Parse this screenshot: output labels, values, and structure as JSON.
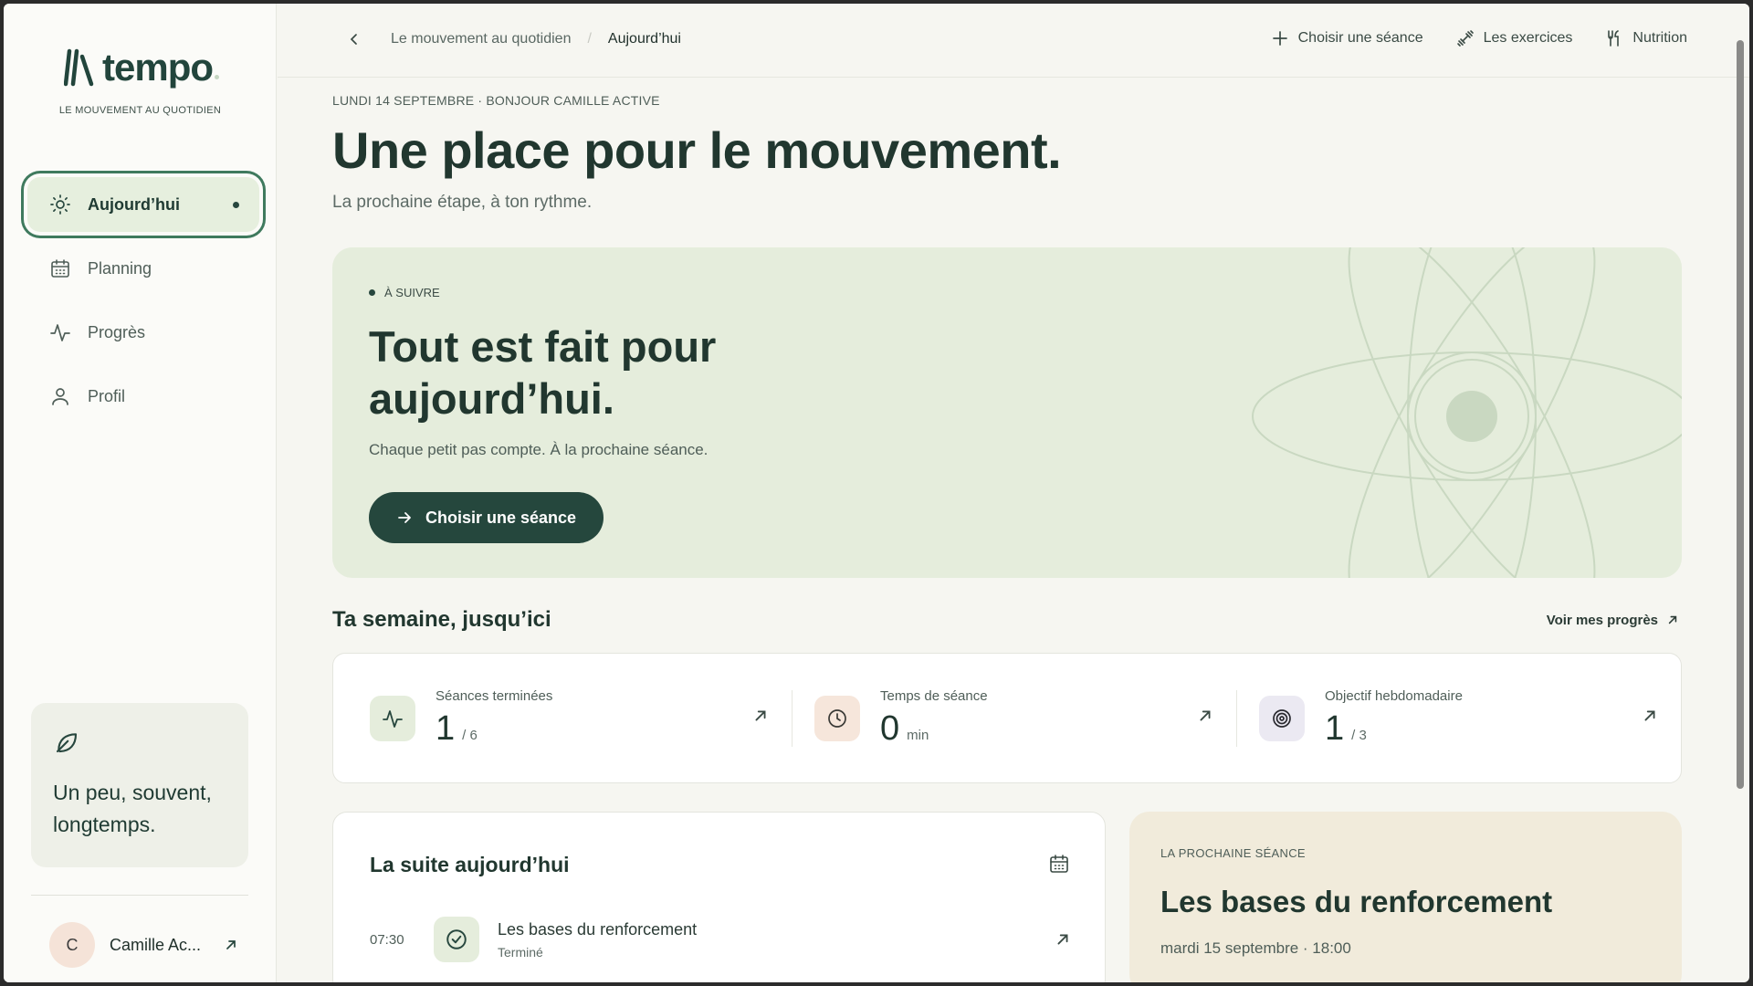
{
  "app": {
    "name": "tempo",
    "tagline": "LE MOUVEMENT AU QUOTIDIEN"
  },
  "sidebar": {
    "items": [
      {
        "label": "Aujourd’hui",
        "icon": "sun-icon",
        "active": true
      },
      {
        "label": "Planning",
        "icon": "calendar-icon",
        "active": false
      },
      {
        "label": "Progrès",
        "icon": "activity-icon",
        "active": false
      },
      {
        "label": "Profil",
        "icon": "user-icon",
        "active": false
      }
    ],
    "quote": "Un peu, souvent, longtemps.",
    "user": {
      "initial": "C",
      "name": "Camille Ac..."
    }
  },
  "topbar": {
    "breadcrumb": [
      "Le mouvement au quotidien",
      "Aujourd’hui"
    ],
    "links": [
      {
        "label": "Choisir une séance",
        "icon": "plus-icon"
      },
      {
        "label": "Les exercices",
        "icon": "dumbbell-icon"
      },
      {
        "label": "Nutrition",
        "icon": "utensils-icon"
      }
    ]
  },
  "hero": {
    "date_line": "LUNDI 14 SEPTEMBRE · BONJOUR CAMILLE ACTIVE",
    "title": "Une place pour le mouvement.",
    "subtitle": "La prochaine étape, à ton rythme."
  },
  "next_card": {
    "tag": "À SUIVRE",
    "title": "Tout est fait pour aujourd’hui.",
    "subtitle": "Chaque petit pas compte. À la prochaine séance.",
    "cta": "Choisir une séance"
  },
  "week": {
    "title": "Ta semaine, jusqu’ici",
    "link": "Voir mes progrès",
    "stats": [
      {
        "label": "Séances terminées",
        "value": "1",
        "unit": "/ 6",
        "icon": "activity-icon",
        "color": "#e5eddc"
      },
      {
        "label": "Temps de séance",
        "value": "0",
        "unit": "min",
        "icon": "clock-icon",
        "color": "#f6e6db"
      },
      {
        "label": "Objectif hebdomadaire",
        "value": "1",
        "unit": "/ 3",
        "icon": "target-icon",
        "color": "#ebe9f2"
      }
    ]
  },
  "today": {
    "title": "La suite aujourd’hui",
    "sessions": [
      {
        "time": "07:30",
        "name": "Les bases du renforcement",
        "status": "Terminé"
      }
    ]
  },
  "upcoming": {
    "tag": "LA PROCHAINE SÉANCE",
    "title": "Les bases du renforcement",
    "date": "mardi 15 septembre · 18:00"
  },
  "colors": {
    "accent": "#25473d",
    "card_green": "#e5eddc",
    "card_sand": "#f1ebdb",
    "background": "#f6f6f1"
  }
}
